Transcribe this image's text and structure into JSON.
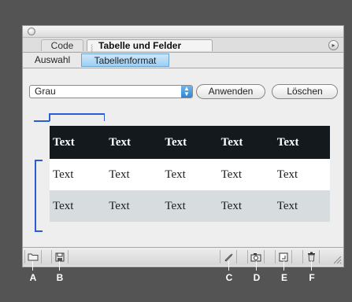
{
  "window": {
    "close_icon": "close-circle-icon",
    "menu_icon": "panel-menu-icon"
  },
  "tabs": [
    {
      "label": "Code"
    },
    {
      "label": "Tabelle und Felder"
    }
  ],
  "subtabs": [
    {
      "label": "Auswahl"
    },
    {
      "label": "Tabellenformat"
    }
  ],
  "format": {
    "selected": "Grau",
    "apply_label": "Anwenden",
    "delete_label": "Löschen"
  },
  "preview": {
    "header": [
      "Text",
      "Text",
      "Text",
      "Text",
      "Text"
    ],
    "rows": [
      [
        "Text",
        "Text",
        "Text",
        "Text",
        "Text"
      ],
      [
        "Text",
        "Text",
        "Text",
        "Text",
        "Text"
      ]
    ],
    "colors": {
      "header_bg": "#14191d",
      "row1_bg": "#ffffff",
      "row2_bg": "#d7dcdf",
      "bracket": "#2a5cd6"
    }
  },
  "bottom_buttons": [
    {
      "icon": "folder-icon"
    },
    {
      "icon": "save-icon"
    },
    {
      "icon": "pen-icon"
    },
    {
      "icon": "camera-icon"
    },
    {
      "icon": "new-style-icon"
    },
    {
      "icon": "trash-icon"
    }
  ],
  "callouts": [
    "A",
    "B",
    "C",
    "D",
    "E",
    "F"
  ]
}
